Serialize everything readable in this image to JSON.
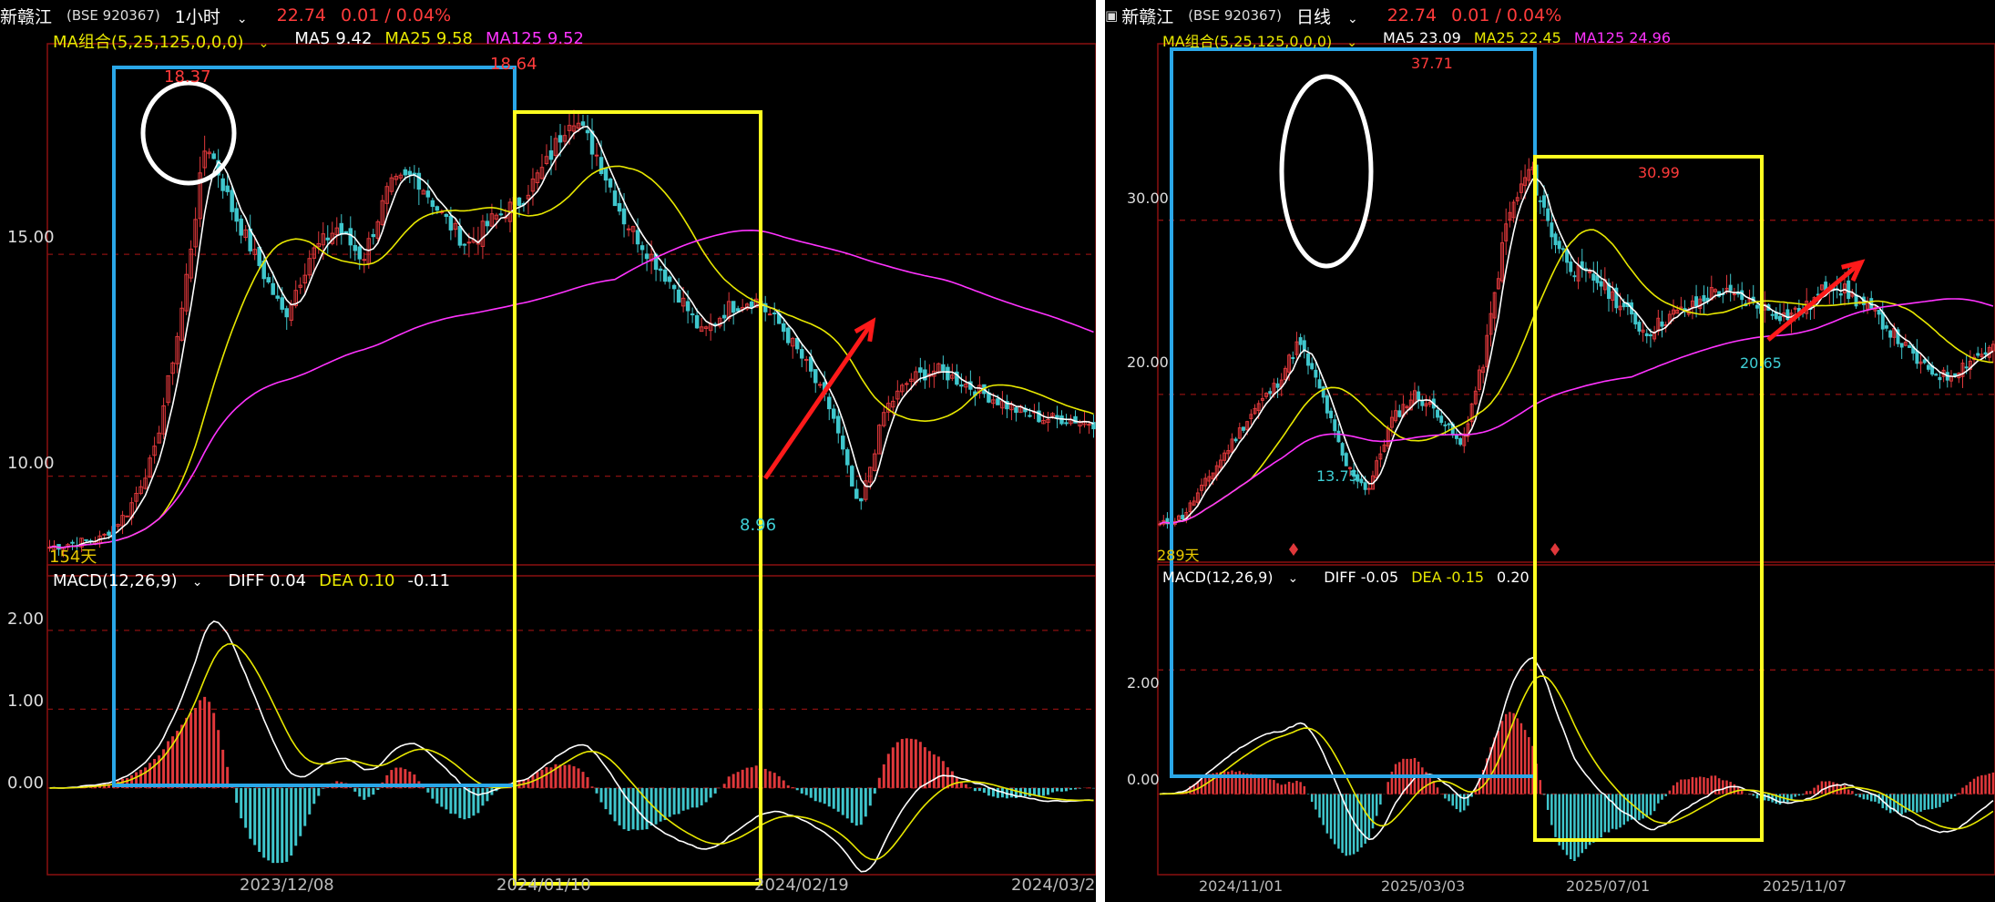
{
  "colors": {
    "up": "#e0383b",
    "down": "#3fc6cc",
    "ma5": "#ffffff",
    "ma25": "#e8e800",
    "ma125": "#ff33ff",
    "grid": "#8a1010",
    "box_blue": "#2aa7e8",
    "box_yellow": "#ffff20",
    "arrow": "#ff1a1a"
  },
  "left": {
    "header": {
      "name": "新赣江",
      "code": "(BSE 920367)",
      "period": "1小时",
      "price": "22.74",
      "change": "0.01 / 0.04%"
    },
    "ma_legend": {
      "label": "MA组合(5,25,125,0,0,0)",
      "ma5": "MA5 9.42",
      "ma25": "MA25 9.58",
      "ma125": "MA125 9.52"
    },
    "macd_legend": {
      "label": "MACD(12,26,9)",
      "diff": "DIFF 0.04",
      "dea": "DEA 0.10",
      "macd": "-0.11"
    },
    "y_labels": [
      "15.00",
      "10.00"
    ],
    "macd_y_labels": [
      "2.00",
      "1.00",
      "0.00"
    ],
    "x_labels": [
      "2023/12/08",
      "2024/01/10",
      "2024/02/19",
      "2024/03/2"
    ],
    "annotations": {
      "high1": "18.37",
      "high2": "18.64",
      "low": "8.96",
      "days": "154天"
    }
  },
  "right": {
    "header": {
      "name": "新赣江",
      "code": "(BSE 920367)",
      "period": "日线",
      "price": "22.74",
      "change": "0.01 / 0.04%"
    },
    "ma_legend": {
      "label": "MA组合(5,25,125,0,0,0)",
      "ma5": "MA5 23.09",
      "ma25": "MA25 22.45",
      "ma125": "MA125 24.96"
    },
    "macd_legend": {
      "label": "MACD(12,26,9)",
      "diff": "DIFF -0.05",
      "dea": "DEA -0.15",
      "macd": "0.20"
    },
    "y_labels": [
      "30.00",
      "20.00"
    ],
    "macd_y_labels": [
      "2.00",
      "0.00"
    ],
    "x_labels": [
      "2024/11/01",
      "2025/03/03",
      "2025/07/01",
      "2025/11/07"
    ],
    "annotations": {
      "high1": "37.71",
      "high2": "30.99",
      "low1": "13.75",
      "low2": "20.65",
      "days": "289天"
    }
  },
  "chart_data": [
    {
      "type": "candlestick",
      "title": "新赣江 (BSE 920367) 1小时",
      "period": "1小时",
      "ylim": [
        8.0,
        19.5
      ],
      "x_ticks": [
        "2023/12/08",
        "2024/01/10",
        "2024/02/19",
        "2024/03/2"
      ],
      "close_path": [
        8.4,
        8.5,
        8.6,
        9.2,
        10.5,
        13.5,
        17.6,
        16.0,
        14.8,
        13.6,
        15.0,
        15.6,
        14.9,
        16.5,
        16.8,
        15.9,
        15.2,
        15.8,
        16.2,
        17.0,
        18.2,
        17.2,
        15.8,
        15.0,
        14.2,
        13.2,
        13.8,
        14.0,
        13.4,
        12.5,
        11.4,
        9.2,
        11.5,
        12.2,
        12.4,
        12.1,
        11.8,
        11.5,
        11.3,
        11.3,
        11.2
      ],
      "high": 18.64,
      "low": 8.96,
      "series": [
        {
          "name": "MA5",
          "last": 9.42
        },
        {
          "name": "MA25",
          "last": 9.58
        },
        {
          "name": "MA125",
          "last": 9.52
        }
      ],
      "macd": {
        "diff": 0.04,
        "dea": 0.1,
        "macd": -0.11,
        "ylim": [
          -1.1,
          2.6
        ]
      },
      "annotations": [
        "18.37",
        "18.64",
        "8.96",
        "154天"
      ]
    },
    {
      "type": "candlestick",
      "title": "新赣江 (BSE 920367) 日线",
      "period": "日线",
      "ylim": [
        11.0,
        39.5
      ],
      "x_ticks": [
        "2024/11/01",
        "2025/03/03",
        "2025/07/01",
        "2025/11/07"
      ],
      "close_path": [
        12.5,
        13.0,
        15.0,
        17.0,
        19.0,
        20.5,
        23.0,
        20.0,
        16.0,
        14.5,
        18.5,
        20.0,
        19.0,
        17.0,
        22.0,
        30.0,
        33.0,
        29.0,
        27.0,
        26.5,
        25.0,
        23.5,
        24.5,
        25.0,
        26.0,
        25.5,
        25.0,
        24.5,
        25.0,
        26.5,
        25.5,
        24.5,
        23.0,
        21.5,
        21.0,
        22.0,
        22.7
      ],
      "high": 37.71,
      "low": 13.75,
      "series": [
        {
          "name": "MA5",
          "last": 23.09
        },
        {
          "name": "MA25",
          "last": 22.45
        },
        {
          "name": "MA125",
          "last": 24.96
        }
      ],
      "macd": {
        "diff": -0.05,
        "dea": -0.15,
        "macd": 0.2,
        "ylim": [
          -1.3,
          3.4
        ]
      },
      "annotations": [
        "37.71",
        "30.99",
        "13.75",
        "20.65",
        "289天"
      ]
    }
  ]
}
